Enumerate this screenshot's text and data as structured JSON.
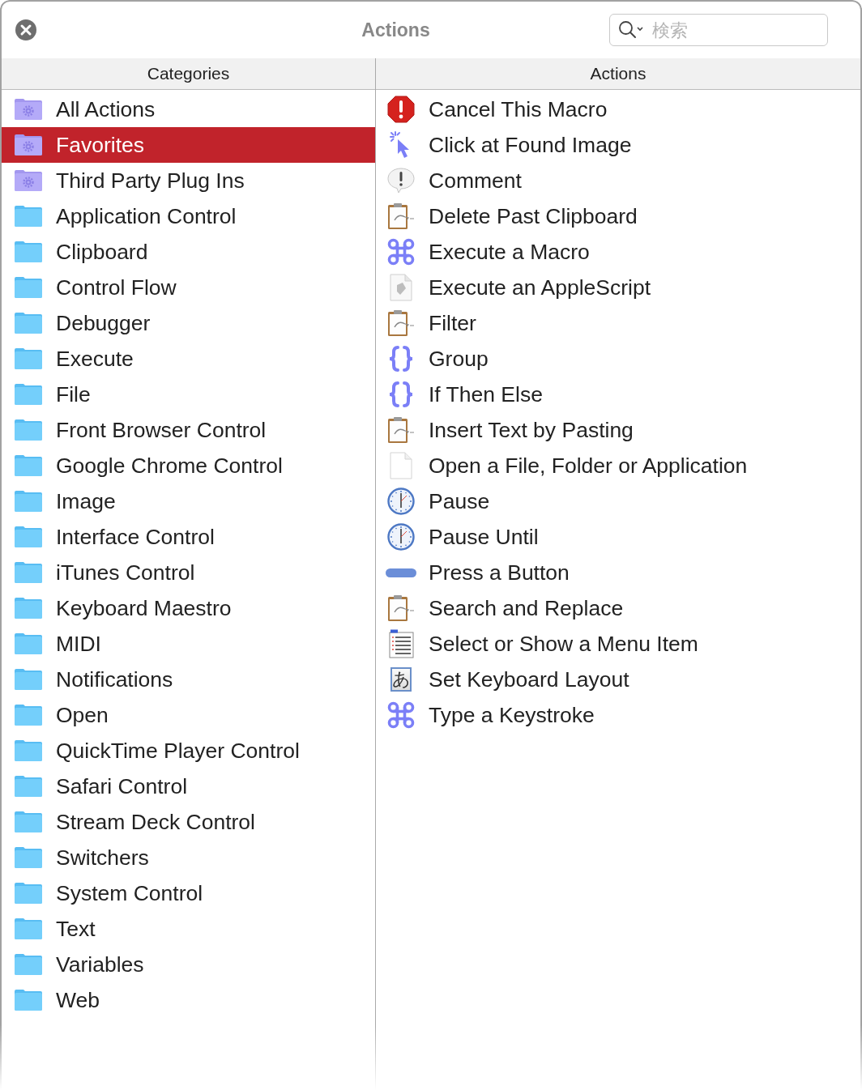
{
  "window": {
    "title": "Actions"
  },
  "search": {
    "placeholder": "検索"
  },
  "categories": {
    "header": "Categories",
    "items": [
      {
        "label": "All Actions",
        "kind": "gear-folder",
        "selected": false
      },
      {
        "label": "Favorites",
        "kind": "gear-folder",
        "selected": true
      },
      {
        "label": "Third Party Plug Ins",
        "kind": "gear-folder",
        "selected": false
      },
      {
        "label": "Application Control",
        "kind": "folder",
        "selected": false
      },
      {
        "label": "Clipboard",
        "kind": "folder",
        "selected": false
      },
      {
        "label": "Control Flow",
        "kind": "folder",
        "selected": false
      },
      {
        "label": "Debugger",
        "kind": "folder",
        "selected": false
      },
      {
        "label": "Execute",
        "kind": "folder",
        "selected": false
      },
      {
        "label": "File",
        "kind": "folder",
        "selected": false
      },
      {
        "label": "Front Browser Control",
        "kind": "folder",
        "selected": false
      },
      {
        "label": "Google Chrome Control",
        "kind": "folder",
        "selected": false
      },
      {
        "label": "Image",
        "kind": "folder",
        "selected": false
      },
      {
        "label": "Interface Control",
        "kind": "folder",
        "selected": false
      },
      {
        "label": "iTunes Control",
        "kind": "folder",
        "selected": false
      },
      {
        "label": "Keyboard Maestro",
        "kind": "folder",
        "selected": false
      },
      {
        "label": "MIDI",
        "kind": "folder",
        "selected": false
      },
      {
        "label": "Notifications",
        "kind": "folder",
        "selected": false
      },
      {
        "label": "Open",
        "kind": "folder",
        "selected": false
      },
      {
        "label": "QuickTime Player Control",
        "kind": "folder",
        "selected": false
      },
      {
        "label": "Safari Control",
        "kind": "folder",
        "selected": false
      },
      {
        "label": "Stream Deck Control",
        "kind": "folder",
        "selected": false
      },
      {
        "label": "Switchers",
        "kind": "folder",
        "selected": false
      },
      {
        "label": "System Control",
        "kind": "folder",
        "selected": false
      },
      {
        "label": "Text",
        "kind": "folder",
        "selected": false
      },
      {
        "label": "Variables",
        "kind": "folder",
        "selected": false
      },
      {
        "label": "Web",
        "kind": "folder",
        "selected": false
      }
    ]
  },
  "actions": {
    "header": "Actions",
    "items": [
      {
        "label": "Cancel This Macro",
        "kind": "stop",
        "selected": false
      },
      {
        "label": "Click at Found Image",
        "kind": "click",
        "selected": false
      },
      {
        "label": "Comment",
        "kind": "comment",
        "selected": false
      },
      {
        "label": "Delete Past Clipboard",
        "kind": "clipboard",
        "selected": false
      },
      {
        "label": "Execute a Macro",
        "kind": "command",
        "selected": false
      },
      {
        "label": "Execute an AppleScript",
        "kind": "script",
        "selected": false
      },
      {
        "label": "Filter",
        "kind": "clipboard",
        "selected": false
      },
      {
        "label": "Group",
        "kind": "braces",
        "selected": false
      },
      {
        "label": "If Then Else",
        "kind": "braces",
        "selected": false
      },
      {
        "label": "Insert Text by Pasting",
        "kind": "clipboard",
        "selected": false
      },
      {
        "label": "Open a File, Folder or Application",
        "kind": "document",
        "selected": false
      },
      {
        "label": "Pause",
        "kind": "clock",
        "selected": false
      },
      {
        "label": "Pause Until",
        "kind": "clock",
        "selected": false
      },
      {
        "label": "Press a Button",
        "kind": "button",
        "selected": false
      },
      {
        "label": "Search and Replace",
        "kind": "clipboard",
        "selected": false
      },
      {
        "label": "Select or Show a Menu Item",
        "kind": "menu",
        "selected": false
      },
      {
        "label": "Set Keyboard Layout",
        "kind": "keyboard",
        "glyph": "あ",
        "selected": false
      },
      {
        "label": "Type a Keystroke",
        "kind": "command",
        "selected": false
      }
    ]
  }
}
